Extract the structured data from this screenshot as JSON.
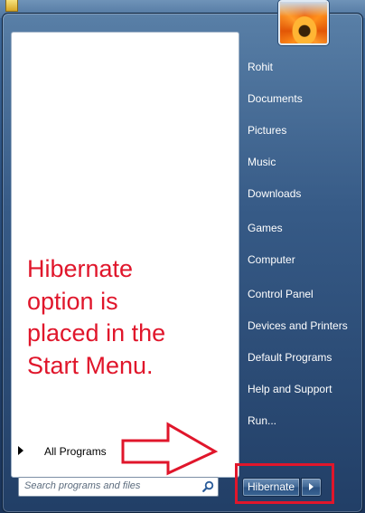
{
  "start_menu": {
    "right_items": [
      {
        "id": "rohit",
        "label": "Rohit"
      },
      {
        "id": "documents",
        "label": "Documents"
      },
      {
        "id": "pictures",
        "label": "Pictures"
      },
      {
        "id": "music",
        "label": "Music"
      },
      {
        "id": "downloads",
        "label": "Downloads"
      },
      {
        "id": "games",
        "label": "Games"
      },
      {
        "id": "computer",
        "label": "Computer"
      },
      {
        "id": "control-panel",
        "label": "Control Panel"
      },
      {
        "id": "devices-and-printers",
        "label": "Devices and Printers"
      },
      {
        "id": "default-programs",
        "label": "Default Programs"
      },
      {
        "id": "help-and-support",
        "label": "Help and Support"
      },
      {
        "id": "run",
        "label": "Run..."
      }
    ],
    "all_programs_label": "All Programs",
    "search_placeholder": "Search programs and files",
    "search_value": "",
    "power_button_label": "Hibernate"
  },
  "annotation": {
    "lines": [
      "Hibernate",
      "option is",
      "placed in the",
      "Start Menu."
    ],
    "color": "#e0162b"
  },
  "icons": {
    "avatar": "flower-avatar-icon",
    "search": "search-icon",
    "power_options": "chevron-right-icon",
    "all_programs": "triangle-right-icon",
    "pointer_arrow": "arrow-right-icon"
  },
  "colors": {
    "annotation_red": "#e0162b",
    "menu_blue": "#2a4f7e"
  }
}
